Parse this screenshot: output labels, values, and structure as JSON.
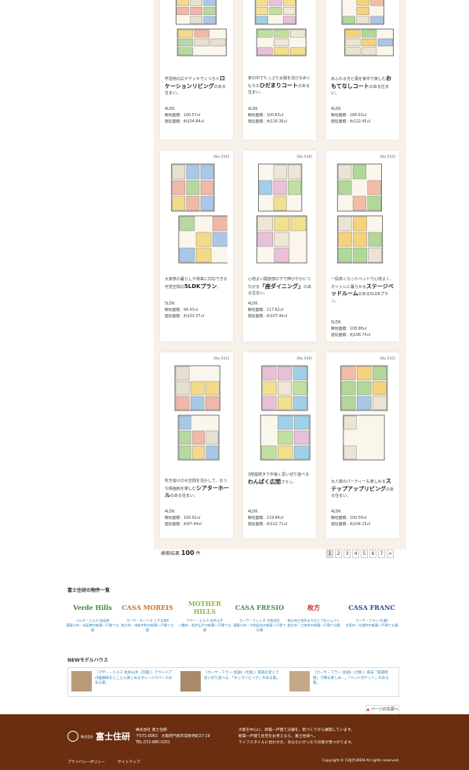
{
  "cards": [
    {
      "num": "",
      "desc_pre": "学習用の広ゲデッキでくつろぐ",
      "desc_bold": "ロケーションリビング",
      "desc_post": "のある住まい。",
      "layout": "4LDK",
      "site": "敷地面積：100.57㎡",
      "floor": "建延面積：約104.84㎡"
    },
    {
      "num": "",
      "desc_pre": "家の中でたっぷり太陽を浴びるぬくもりの",
      "desc_bold": "ひだまりコート",
      "desc_post": "のある住まい。",
      "layout": "4LDK",
      "site": "敷地面積：100.63㎡",
      "floor": "建延面積：約116.36㎡"
    },
    {
      "num": "",
      "desc_pre": "あふれる光と風を家中で楽しむ",
      "desc_bold": "おもてなしコート",
      "desc_post": "のある住まい。",
      "layout": "4LDK",
      "site": "敷地面積：186.63㎡",
      "floor": "建延面積：約122.45㎡"
    },
    {
      "num": "[No.556]",
      "desc_pre": "大家族の暮らしや将来に対応できる可変空間の",
      "desc_bold": "5LDKプラン",
      "desc_post": "。",
      "layout": "5LDK",
      "site": "敷地面積：94.43㎡",
      "floor": "建延面積：約101.07㎡"
    },
    {
      "num": "[No.548]",
      "desc_pre": "心地よい開放感の下で伸びやかにつながる",
      "desc_bold": "「座ダイニング」",
      "desc_post": "のある住まい。",
      "layout": "4LDK",
      "site": "敷地面積：117.62㎡",
      "floor": "建延面積：約107.44㎡"
    },
    {
      "num": "[No.550]",
      "desc_pre": "一段高くなったベッドで心地よく、オシャレに暮らせる",
      "desc_bold": "ステージベッドルーム",
      "desc_post": "のある5LDKプラン。",
      "layout": "5LDK",
      "site": "敷地面積：108.98㎡",
      "floor": "建延面積：約108.74㎡"
    },
    {
      "num": "[No.542]",
      "desc_pre": "吹き抜けの大空間を活かして、おうち映画館を楽しむ",
      "desc_bold": "シアターホール",
      "desc_post": "のある住まい。",
      "layout": "4LDK",
      "site": "敷地面積：100.92㎡",
      "floor": "建延面積：約97.44㎡"
    },
    {
      "num": "[No.546]",
      "desc_pre": "3部屋続きで中良く思い切り遊べる",
      "desc_bold": "わんぱく広間",
      "desc_post": "プラン。",
      "layout": "4LDK",
      "site": "敷地面積：119.84㎡",
      "floor": "建延面積：約122.71㎡"
    },
    {
      "num": "[No.535]",
      "desc_pre": "大人数のパーティーも楽しめる",
      "desc_bold": "ステップアップリビング",
      "desc_post": "のある住まい。",
      "layout": "4LDK",
      "site": "敷地面積：100.56㎡",
      "floor": "建延面積：約104.15㎡"
    }
  ],
  "results": {
    "label": "検索結果",
    "count": "100",
    "unit": "件"
  },
  "pager": [
    "1",
    "2",
    "3",
    "4",
    "5",
    "6",
    "7",
    ">"
  ],
  "brands_title": "富士住研の物件一覧",
  "brands": [
    {
      "logo": "Verde Hills",
      "logo_sub": "ベルデ・ヒルズ 成田南",
      "cap": "ベルデ・ヒルズ 成田南\n寝屋川市・成田南の新築一戸建て分譲",
      "color": "#3a8a3a"
    },
    {
      "logo": "CASA MOREIS",
      "logo_sub": "",
      "cap": "カーサ・モーリス くずは南Ⅱ\n枚方市・市駅中町の新築一戸建て分譲",
      "color": "#c8741c"
    },
    {
      "logo": "MOTHER HILLS",
      "logo_sub": "",
      "cap": "マザー・ヒルズ 松井山手\n八幡市・松井山手の新築一戸建て分譲",
      "color": "#8ab840"
    },
    {
      "logo": "CASA FRESIO",
      "logo_sub": "",
      "cap": "カーサ・フレシオ 大和田北\n寝屋川市・大和田北の新築一戸建て分譲",
      "color": "#4a8a4a"
    },
    {
      "logo": "枚方",
      "logo_sub": "",
      "cap": "枚方市三矢町まちびとプロジェクト\n枚方市・三矢町の新築一戸建て分譲",
      "color": "#c03030"
    },
    {
      "logo": "CASA FRANC",
      "logo_sub": "",
      "cap": "カーサ・フラン 住道Ⅱ\n大東市・住道町の新築一戸建て分譲",
      "color": "#2a4a9a"
    }
  ],
  "model_title": "NEWモデルハウス",
  "models": [
    {
      "text": "［マザー・ヒルズ 松井山手（京都）］アウトドアの醍醐味をとことん楽しめるガレージスペースのある家。"
    },
    {
      "text": "［カーサ・フラン 住道Ⅱ（大阪）］家族の近くで思い切り遊べる、「キッズリビング」のある家。"
    },
    {
      "text": "［カーサ・フラン 住道Ⅱ（大阪）］毎日「家族時間」で輝る楽しみ…。「ペッドポケット」のある家。"
    }
  ],
  "pagetop": "ページの先頭へ",
  "footer": {
    "logo_small": "株式会社",
    "logo_big": "富士住研",
    "company": "株式会社 富士住研",
    "zip": "〒571-0063　大阪府門真市常称寺町27-19",
    "tel": "TEL.072-885-0251",
    "msg1": "大阪を中心に、新築一戸建て分譲を、街づくりから展開しています。",
    "msg2": "新築一戸建て住宅をお考えなら、富士住研へ。",
    "msg3": "ライフスタイルに合わせた、あなたにぴったりの家が見つかります。",
    "link1": "プライバシーポリシー",
    "link2": "サイトマップ",
    "copy": "Copyright © FUJIJYUKEN All rights reserved."
  }
}
